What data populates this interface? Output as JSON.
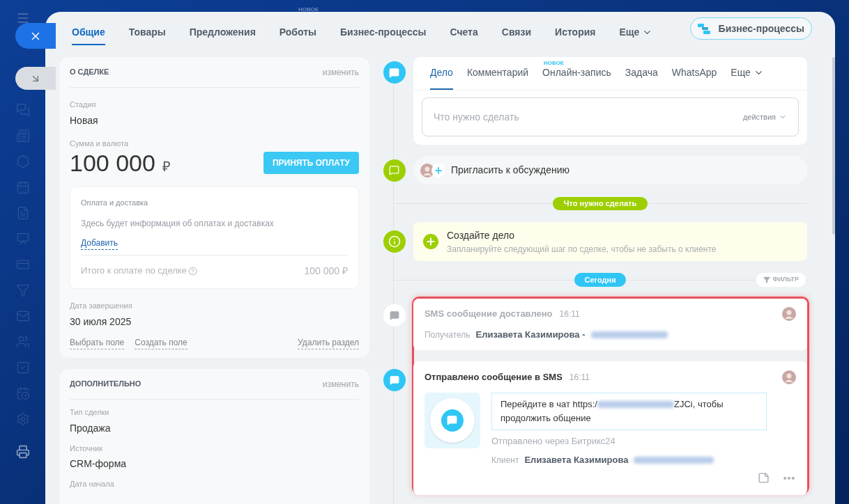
{
  "background_badge": "НОВОЕ",
  "tabs": [
    {
      "label": "Общие",
      "selected": true,
      "kind": "tab"
    },
    {
      "label": "Товары",
      "selected": false,
      "kind": "tab"
    },
    {
      "label": "Предложения",
      "selected": false,
      "kind": "tab"
    },
    {
      "label": "Роботы",
      "selected": false,
      "kind": "tab"
    },
    {
      "label": "Бизнес-процессы",
      "selected": false,
      "kind": "tab"
    },
    {
      "label": "Счета",
      "selected": false,
      "kind": "tab"
    },
    {
      "label": "Связи",
      "selected": false,
      "kind": "tab"
    },
    {
      "label": "История",
      "selected": false,
      "kind": "tab"
    },
    {
      "label": "Еще",
      "selected": false,
      "kind": "menu"
    }
  ],
  "header_button": "Бизнес-процессы",
  "deal_card": {
    "title": "О СДЕЛКЕ",
    "edit": "изменить",
    "stage": {
      "label": "Стадия",
      "value": "Новая"
    },
    "amount_label": "Сумма и валюта",
    "amount": "100 000",
    "currency": "₽",
    "pay_button": "ПРИНЯТЬ ОПЛАТУ",
    "payment": {
      "title": "Оплата и доставка",
      "hint": "Здесь будет информация об оплатах и доставках",
      "add_link": "Добавить",
      "total_label": "Итого к оплате по сделке",
      "total": "100 000 ₽"
    },
    "end_date": {
      "label": "Дата завершения",
      "value": "30 июля 2025"
    },
    "links": [
      "Выбрать поле",
      "Создать поле"
    ],
    "delete_link": "Удалить раздел"
  },
  "extra_card": {
    "title": "ДОПОЛНИТЕЛЬНО",
    "edit": "изменить",
    "fields": [
      {
        "label": "Тип сделки",
        "value": "Продажа"
      },
      {
        "label": "Источник",
        "value": "CRM-форма"
      },
      {
        "label": "Дата начала"
      }
    ]
  },
  "composer": {
    "tabs": [
      {
        "label": "Дело",
        "selected": true,
        "kind": "tab"
      },
      {
        "label": "Комментарий",
        "selected": false,
        "kind": "tab"
      },
      {
        "label": "Онлайн-запись",
        "selected": false,
        "kind": "tab",
        "badge": "НОВОЕ"
      },
      {
        "label": "Задача",
        "selected": false,
        "kind": "tab"
      },
      {
        "label": "WhatsApp",
        "selected": false,
        "kind": "tab"
      },
      {
        "label": "Еще",
        "selected": false,
        "kind": "menu"
      }
    ],
    "placeholder": "Что нужно сделать",
    "actions": "действия"
  },
  "invite": "Пригласить к обсуждению",
  "todo_divider": "Что нужно сделать",
  "create_task": {
    "title": "Создайте дело",
    "subtitle": "Запланируйте следующий шаг по сделке, чтобы не забыть о клиенте"
  },
  "today_divider": "Сегодня",
  "filter": "ФИЛЬТР",
  "events": [
    {
      "kind": "delivered",
      "title": "SMS сообщение доставлено",
      "time": "16:11",
      "label": "Получатель",
      "name": "Елизавета Казимирова -"
    },
    {
      "kind": "sent",
      "title": "Отправлено сообщение в SMS",
      "time": "16:11",
      "message_start": "Перейдите в чат https:/",
      "message_end": "ZJCi, чтобы",
      "message_line2": "продолжить общение",
      "via": "Отправлено через Битрикс24",
      "label": "Клиент",
      "name": "Елизавета Казимирова"
    }
  ]
}
